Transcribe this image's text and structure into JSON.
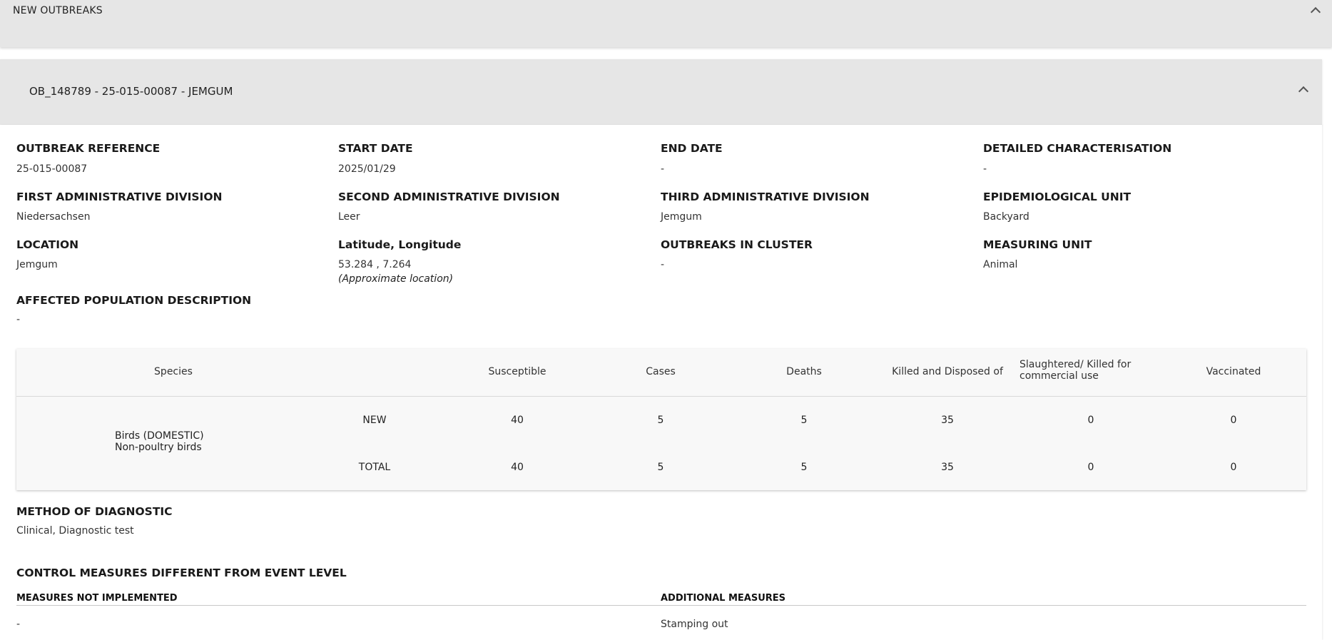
{
  "outbreaks_section": {
    "title": "NEW OUTBREAKS"
  },
  "outbreak": {
    "header": "OB_148789 - 25-015-00087 - JEMGUM",
    "fields": {
      "outbreak_reference": {
        "label": "OUTBREAK REFERENCE",
        "value": "25-015-00087"
      },
      "start_date": {
        "label": "START DATE",
        "value": "2025/01/29"
      },
      "end_date": {
        "label": "END DATE",
        "value": "-"
      },
      "detailed_characterisation": {
        "label": "DETAILED CHARACTERISATION",
        "value": "-"
      },
      "first_admin": {
        "label": "FIRST ADMINISTRATIVE DIVISION",
        "value": "Niedersachsen"
      },
      "second_admin": {
        "label": "SECOND ADMINISTRATIVE DIVISION",
        "value": "Leer"
      },
      "third_admin": {
        "label": "THIRD ADMINISTRATIVE DIVISION",
        "value": "Jemgum"
      },
      "epi_unit": {
        "label": "EPIDEMIOLOGICAL UNIT",
        "value": "Backyard"
      },
      "location": {
        "label": "LOCATION",
        "value": "Jemgum"
      },
      "latlong": {
        "label": "Latitude, Longitude",
        "value": "53.284 , 7.264",
        "note": "(Approximate location)"
      },
      "outbreaks_in_cluster": {
        "label": "OUTBREAKS IN CLUSTER",
        "value": "-"
      },
      "measuring_unit": {
        "label": "MEASURING UNIT",
        "value": "Animal"
      },
      "affected_population": {
        "label": "AFFECTED POPULATION DESCRIPTION",
        "value": "-"
      }
    },
    "population_table": {
      "headers": {
        "species": "Species",
        "susceptible": "Susceptible",
        "cases": "Cases",
        "deaths": "Deaths",
        "killed": "Killed and Disposed of",
        "slaughtered_line1": "Slaughtered/ Killed for",
        "slaughtered_line2": "commercial use",
        "vaccinated": "Vaccinated"
      },
      "species_line1": "Birds (DOMESTIC)",
      "species_line2": "Non-poultry birds",
      "rows": [
        {
          "type": "NEW",
          "susceptible": "40",
          "cases": "5",
          "deaths": "5",
          "killed": "35",
          "slaughtered": "0",
          "vaccinated": "0"
        },
        {
          "type": "TOTAL",
          "susceptible": "40",
          "cases": "5",
          "deaths": "5",
          "killed": "35",
          "slaughtered": "0",
          "vaccinated": "0"
        }
      ]
    },
    "diagnostic": {
      "label": "METHOD OF DIAGNOSTIC",
      "value": "Clinical, Diagnostic test"
    },
    "control_measures": {
      "title": "CONTROL MEASURES DIFFERENT FROM EVENT LEVEL",
      "not_implemented_label": "MEASURES NOT IMPLEMENTED",
      "not_implemented_value": "-",
      "additional_label": "ADDITIONAL MEASURES",
      "additional_value": "Stamping out"
    }
  }
}
